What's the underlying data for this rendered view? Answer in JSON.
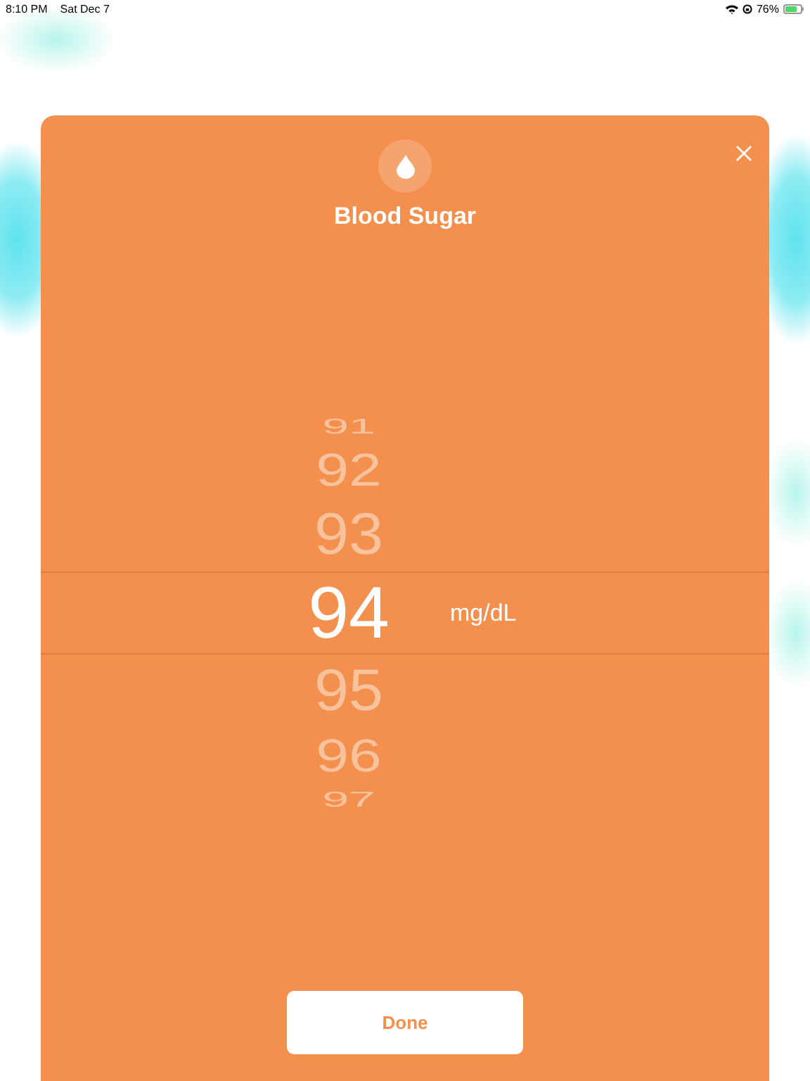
{
  "status_bar": {
    "time": "8:10 PM",
    "date": "Sat Dec 7",
    "battery": "76%"
  },
  "modal": {
    "title": "Blood Sugar",
    "unit": "mg/dL",
    "done_button": "Done",
    "picker": [
      {
        "value": "91",
        "selected": false
      },
      {
        "value": "92",
        "selected": false
      },
      {
        "value": "93",
        "selected": false
      },
      {
        "value": "94",
        "selected": true
      },
      {
        "value": "95",
        "selected": false
      },
      {
        "value": "96",
        "selected": false
      },
      {
        "value": "97",
        "selected": false
      }
    ]
  }
}
